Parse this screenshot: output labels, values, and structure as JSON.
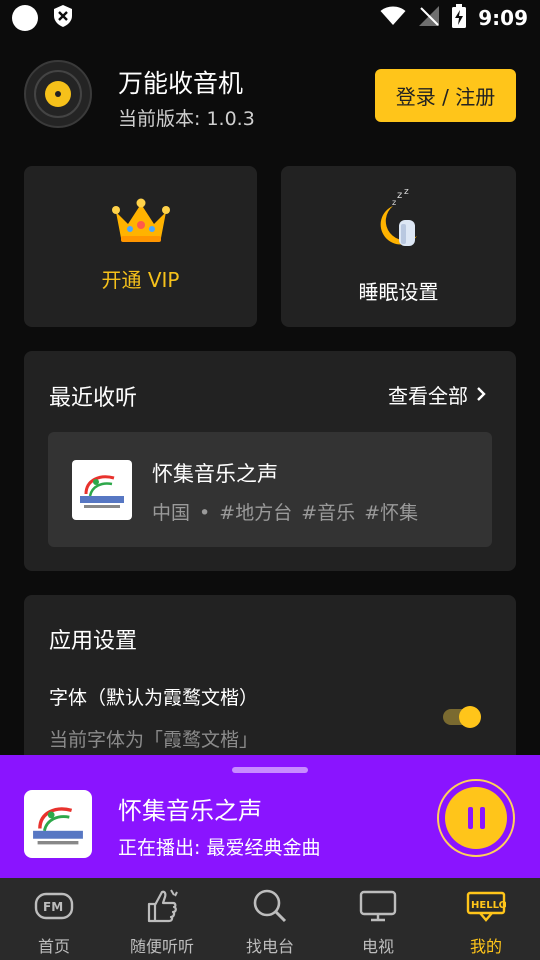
{
  "status_bar": {
    "time": "9:09"
  },
  "header": {
    "app_title": "万能收音机",
    "version_text": "当前版本: 1.0.3",
    "login_label": "登录 / 注册"
  },
  "cards": {
    "vip_label": "开通 VIP",
    "sleep_label": "睡眠设置"
  },
  "recent": {
    "title": "最近收听",
    "view_all": "查看全部",
    "item": {
      "name": "怀集音乐之声",
      "tags": "中国 • #地方台 #音乐 #怀集"
    }
  },
  "settings": {
    "title": "应用设置",
    "font_label": "字体（默认为霞鹜文楷）",
    "font_sub": "当前字体为「霞鹜文楷」",
    "font_toggle_on": true
  },
  "player": {
    "title": "怀集音乐之声",
    "subtitle": "正在播出: 最爱经典金曲"
  },
  "nav": {
    "items": [
      {
        "label": "首页",
        "icon": "fm-radio-icon"
      },
      {
        "label": "随便听听",
        "icon": "hand-gesture-icon"
      },
      {
        "label": "找电台",
        "icon": "search-icon"
      },
      {
        "label": "电视",
        "icon": "tv-icon"
      },
      {
        "label": "我的",
        "icon": "hello-badge-icon",
        "badge": "HELLO"
      }
    ],
    "active_index": 4
  },
  "colors": {
    "accent_yellow": "#ffc51a",
    "player_purple": "#8a14ff",
    "card_bg": "#222222",
    "page_bg": "#0c0c0c"
  }
}
